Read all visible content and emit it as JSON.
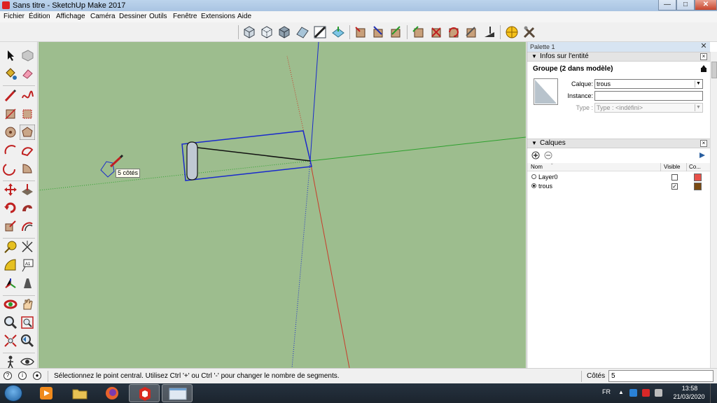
{
  "window": {
    "title": "Sans titre - SketchUp Make 2017",
    "minimize_icon": "minimize-icon",
    "maximize_icon": "maximize-icon",
    "close_icon": "close-icon"
  },
  "menu": {
    "items": [
      "Fichier",
      "Édition",
      "Affichage",
      "Caméra",
      "Dessiner",
      "Outils",
      "Fenêtre",
      "Extensions",
      "Aide"
    ]
  },
  "viewport": {
    "tooltip": "5 côtés",
    "background_color": "#9dbd8e",
    "axis_colors": {
      "blue": "#1a2acc",
      "green": "#2da02d",
      "red": "#c83c2a"
    }
  },
  "palette": {
    "title": "Palette 1",
    "entity_info": {
      "header": "Infos sur l'entité",
      "group_label": "Groupe (2 dans modèle)",
      "layer_label": "Calque:",
      "layer_value": "trous",
      "instance_label": "Instance:",
      "instance_value": "",
      "type_label": "Type :",
      "type_value": "Type : <indéfini>"
    },
    "layers": {
      "header": "Calques",
      "columns": [
        "Nom",
        "Visible",
        "Co..."
      ],
      "rows": [
        {
          "name": "Layer0",
          "active": false,
          "visible": false,
          "color": "#e8524a"
        },
        {
          "name": "trous",
          "active": true,
          "visible": true,
          "color": "#7a4a12"
        }
      ]
    }
  },
  "status": {
    "message": "Sélectionnez le point central. Utilisez Ctrl '+' ou Ctrl '-' pour changer le nombre de segments.",
    "vcb_label": "Côtés",
    "vcb_value": "5"
  },
  "taskbar": {
    "language": "FR",
    "time": "13:58",
    "date": "21/03/2020"
  }
}
